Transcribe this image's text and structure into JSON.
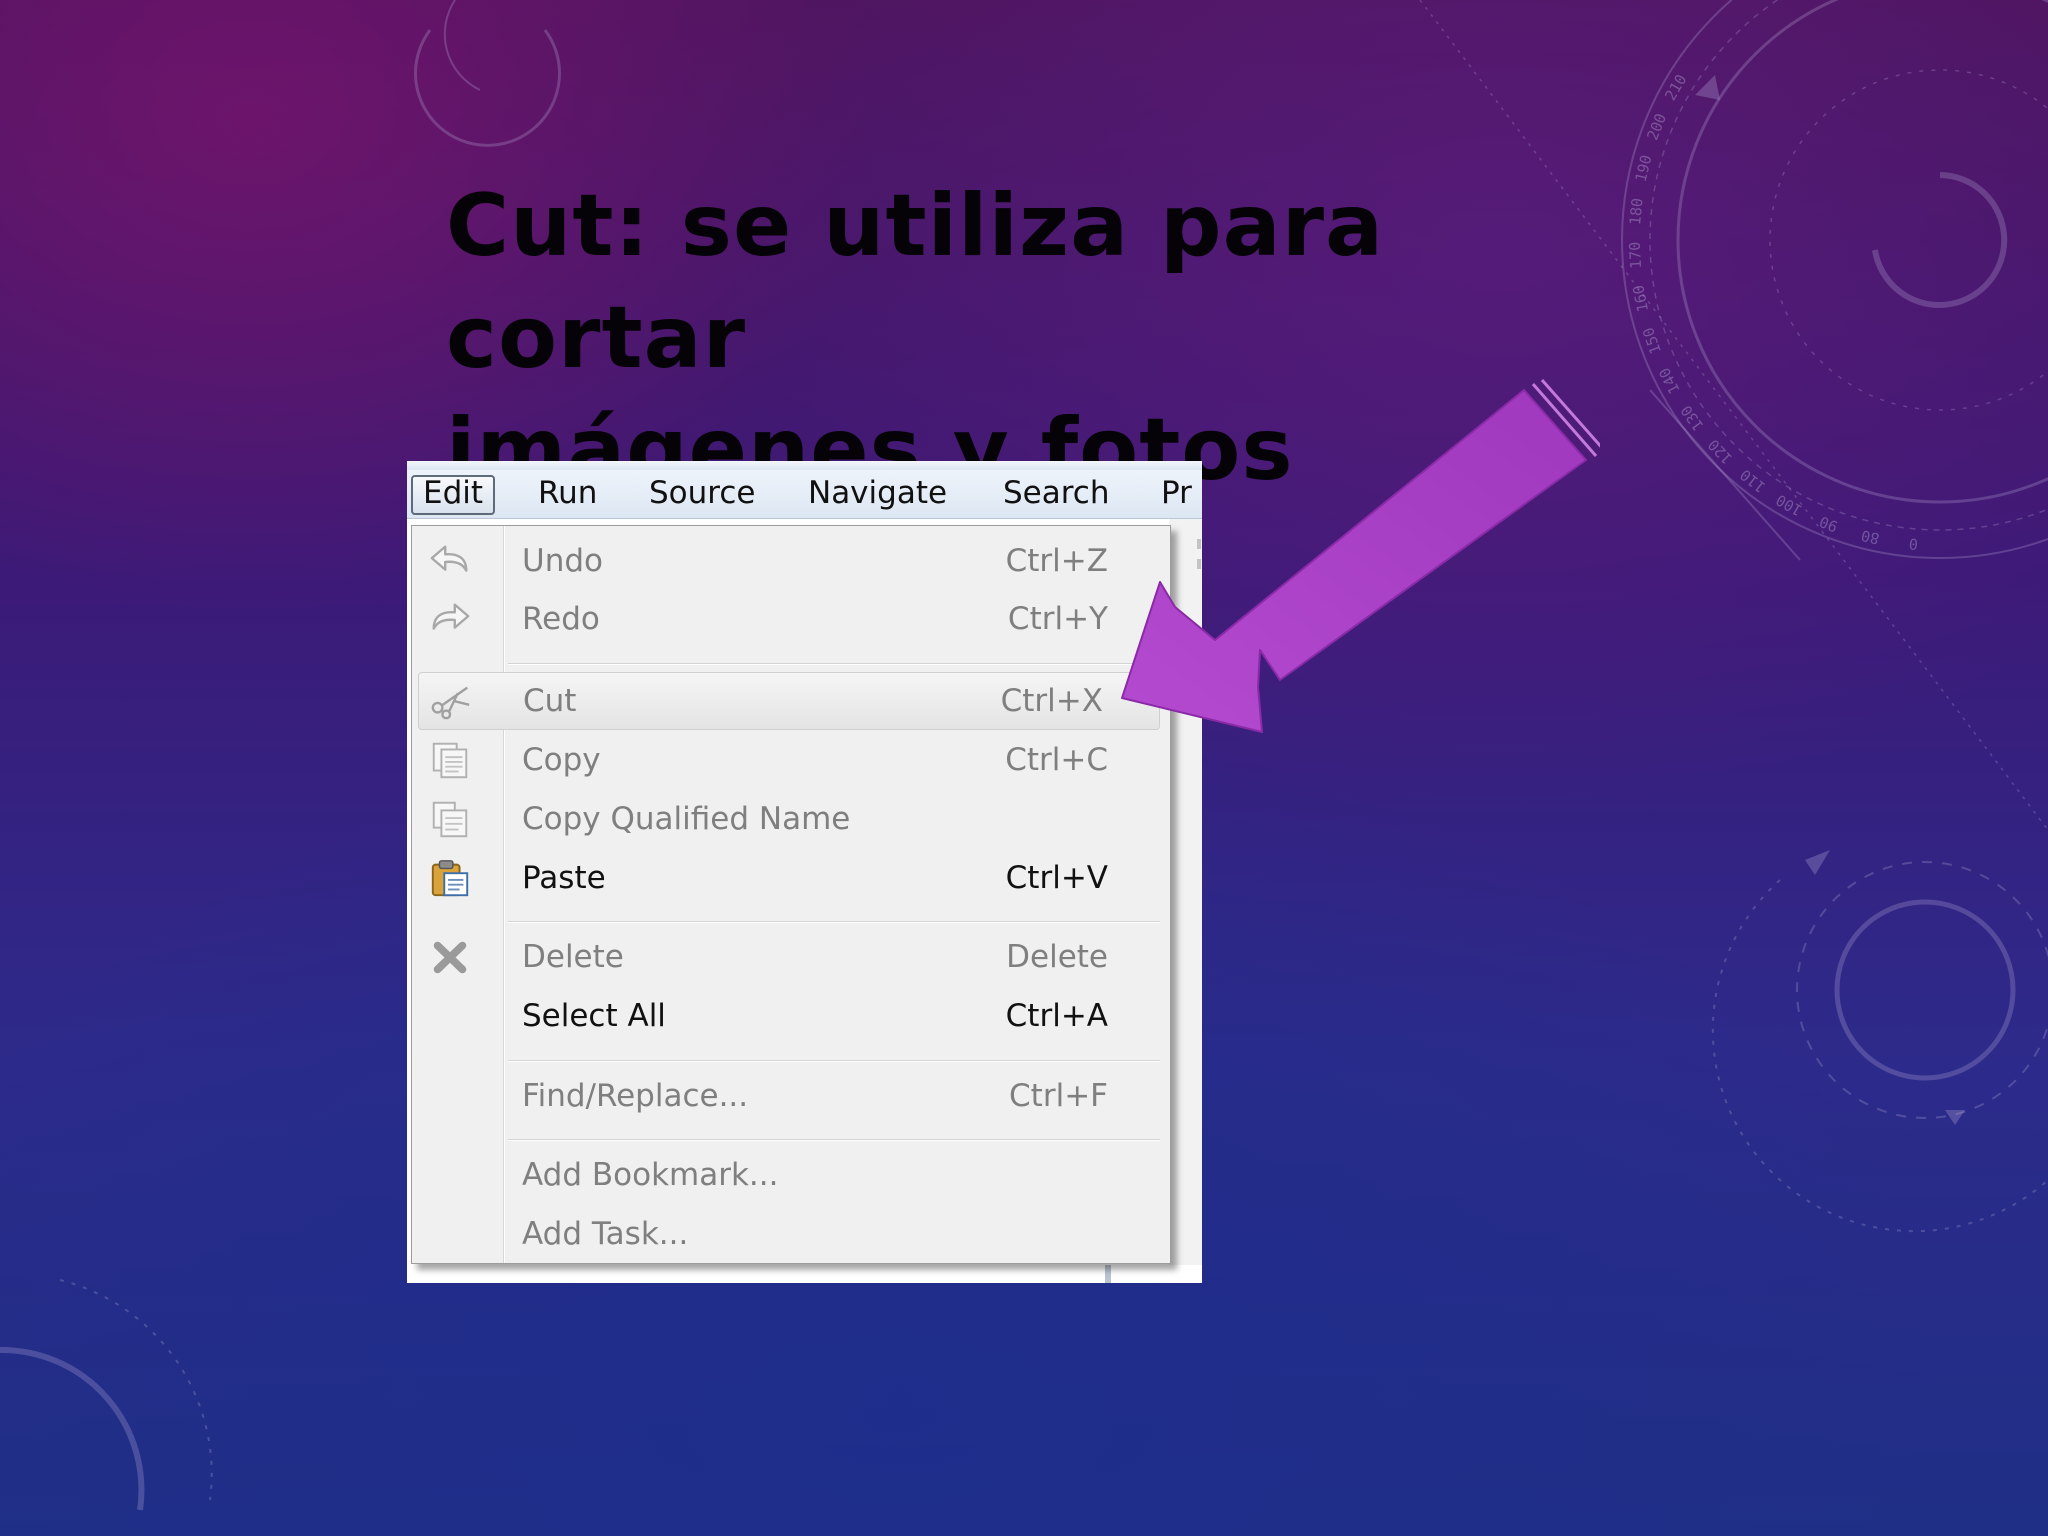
{
  "slide": {
    "title_line1": "Cut: se utiliza para cortar",
    "title_line2": "imágenes y fotos"
  },
  "menubar": {
    "items": [
      {
        "label": "Edit",
        "active": true
      },
      {
        "label": "Run"
      },
      {
        "label": "Source"
      },
      {
        "label": "Navigate"
      },
      {
        "label": "Search"
      },
      {
        "label": "Pr"
      }
    ]
  },
  "edit_menu": {
    "items": [
      {
        "label": "Undo",
        "shortcut": "Ctrl+Z",
        "icon": "undo-icon",
        "enabled": false
      },
      {
        "label": "Redo",
        "shortcut": "Ctrl+Y",
        "icon": "redo-icon",
        "enabled": false
      },
      {
        "label": "Cut",
        "shortcut": "Ctrl+X",
        "icon": "scissors-icon",
        "enabled": false,
        "highlighted": true
      },
      {
        "label": "Copy",
        "shortcut": "Ctrl+C",
        "icon": "copy-icon",
        "enabled": false
      },
      {
        "label": "Copy Qualified Name",
        "shortcut": "",
        "icon": "copy-qualified-name-icon",
        "enabled": false
      },
      {
        "label": "Paste",
        "shortcut": "Ctrl+V",
        "icon": "paste-icon",
        "enabled": true
      },
      {
        "label": "Delete",
        "shortcut": "Delete",
        "icon": "delete-icon",
        "enabled": false
      },
      {
        "label": "Select All",
        "shortcut": "Ctrl+A",
        "enabled": true
      },
      {
        "label": "Find/Replace...",
        "shortcut": "Ctrl+F",
        "enabled": false
      },
      {
        "label": "Add Bookmark...",
        "shortcut": "",
        "enabled": false
      },
      {
        "label": "Add Task...",
        "shortcut": "",
        "enabled": false
      }
    ]
  },
  "colors": {
    "background_top": "#4e1560",
    "background_bottom": "#1f2f86",
    "arrow": "#a93fc4",
    "title": "#050308",
    "menu_disabled_text": "#7f7f7f",
    "menu_enabled_text": "#111111"
  },
  "decor": {
    "dial_ticks": [
      "210",
      "200",
      "190",
      "180",
      "170",
      "160",
      "150",
      "140",
      "130",
      "120",
      "110",
      "100",
      "90",
      "80",
      "0"
    ]
  }
}
